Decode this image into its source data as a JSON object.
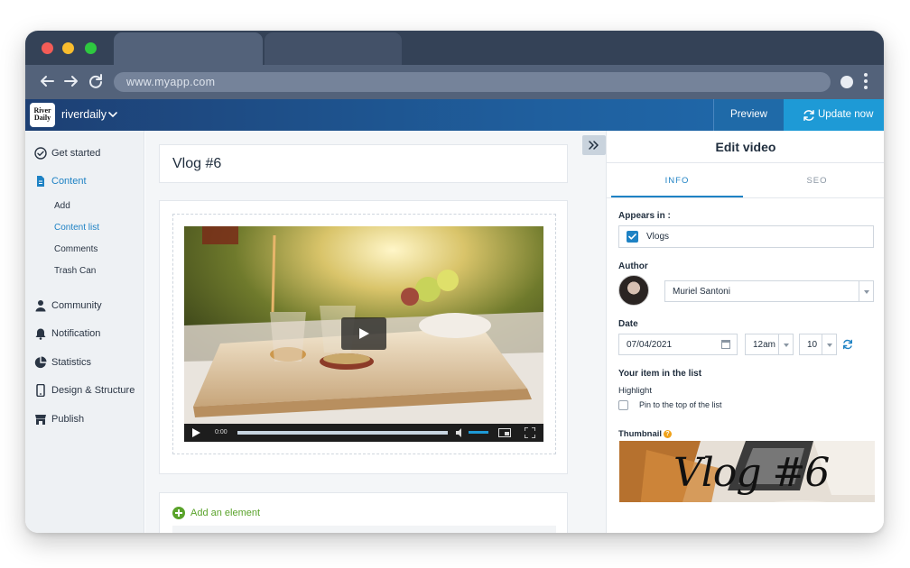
{
  "browser": {
    "url": "www.myapp.com",
    "controls": [
      "close",
      "minimize",
      "maximize"
    ],
    "nav_icons": [
      "back-arrow-icon",
      "forward-arrow-icon",
      "reload-icon"
    ]
  },
  "header": {
    "logo_text": "River Daily",
    "site_name": "riverdaily",
    "preview_label": "Preview",
    "update_label": "Update now",
    "colors": {
      "header_start": "#1d3f73",
      "update_button": "#1e9ad6"
    }
  },
  "sidebar": {
    "items": [
      {
        "label": "Get started",
        "icon": "check-circle-icon"
      },
      {
        "label": "Content",
        "icon": "document-icon",
        "active": true
      },
      {
        "label": "Community",
        "icon": "person-icon"
      },
      {
        "label": "Notification",
        "icon": "bell-icon"
      },
      {
        "label": "Statistics",
        "icon": "pie-chart-icon"
      },
      {
        "label": "Design & Structure",
        "icon": "mobile-icon"
      },
      {
        "label": "Publish",
        "icon": "store-icon"
      }
    ],
    "content_sub": [
      {
        "label": "Add"
      },
      {
        "label": "Content list",
        "active": true
      },
      {
        "label": "Comments"
      },
      {
        "label": "Trash Can"
      }
    ]
  },
  "main": {
    "title": "Vlog #6",
    "video": {
      "time": "0:00"
    },
    "add_element_label": "Add an element"
  },
  "panel": {
    "title": "Edit video",
    "tabs": [
      "INFO",
      "SEO"
    ],
    "appears_in_label": "Appears in :",
    "appears_in_value": "Vlogs",
    "author_label": "Author",
    "author_value": "Muriel Santoni",
    "date_label": "Date",
    "date_value": "07/04/2021",
    "hour_value": "12am",
    "minute_value": "10",
    "list_section_label": "Your item in the list",
    "highlight_label": "Highlight",
    "pin_label": "Pin to the top of the list",
    "thumbnail_label": "Thumbnail",
    "thumbnail_text": "Vlog #6",
    "accent_color": "#1e82c4"
  }
}
